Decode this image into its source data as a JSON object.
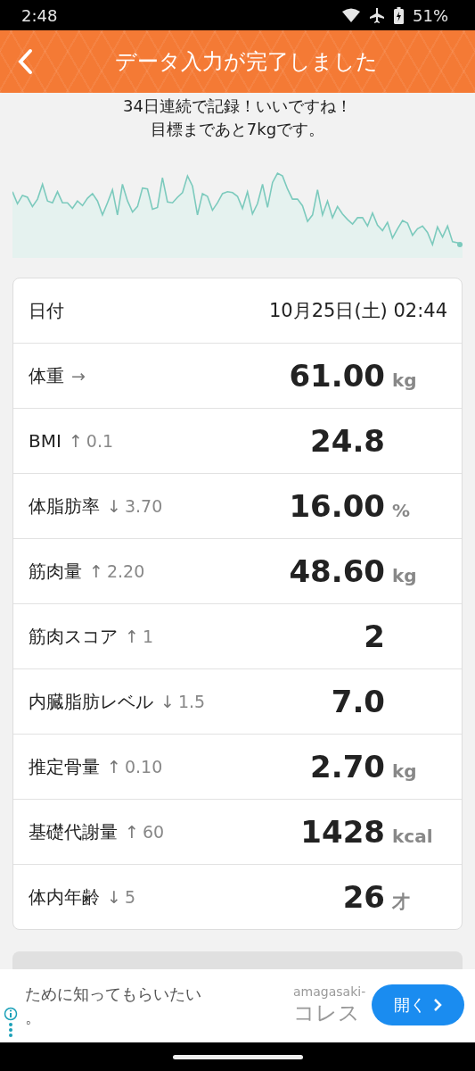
{
  "status_bar": {
    "time": "2:48",
    "battery": "51%"
  },
  "header": {
    "title": "データ入力が完了しました"
  },
  "message": {
    "lines": [
      "34日連続で記録！いいですね！",
      "目標まであと7kgです。"
    ]
  },
  "date_row": {
    "label": "日付",
    "value": "10月25日(土) 02:44"
  },
  "rows": [
    {
      "label": "体重",
      "arrow": "→",
      "value": "61.00",
      "unit": "kg"
    },
    {
      "label": "BMI",
      "arrow": "↑",
      "change": "0.1",
      "value": "24.8"
    },
    {
      "label": "体脂肪率",
      "arrow": "↓",
      "change": "3.70",
      "value": "16.00",
      "unit": "%"
    },
    {
      "label": "筋肉量",
      "arrow": "↑",
      "change": "2.20",
      "value": "48.60",
      "unit": "kg"
    },
    {
      "label": "筋肉スコア",
      "arrow": "↑",
      "change": "1",
      "value": "2"
    },
    {
      "label": "内臓脂肪レベル",
      "arrow": "↓",
      "change": "1.5",
      "value": "7.0"
    },
    {
      "label": "推定骨量",
      "arrow": "↑",
      "change": "0.10",
      "value": "2.70",
      "unit": "kg"
    },
    {
      "label": "基礎代謝量",
      "arrow": "↑",
      "change": "60",
      "value": "1428",
      "unit": "kcal"
    },
    {
      "label": "体内年齢",
      "arrow": "↓",
      "change": "5",
      "value": "26",
      "unit": "才"
    }
  ],
  "ad": {
    "text_lines": [
      "ために知ってもらいたい",
      "。"
    ],
    "domain": "amagasaki-",
    "headline": "コレス",
    "button": "開く"
  }
}
